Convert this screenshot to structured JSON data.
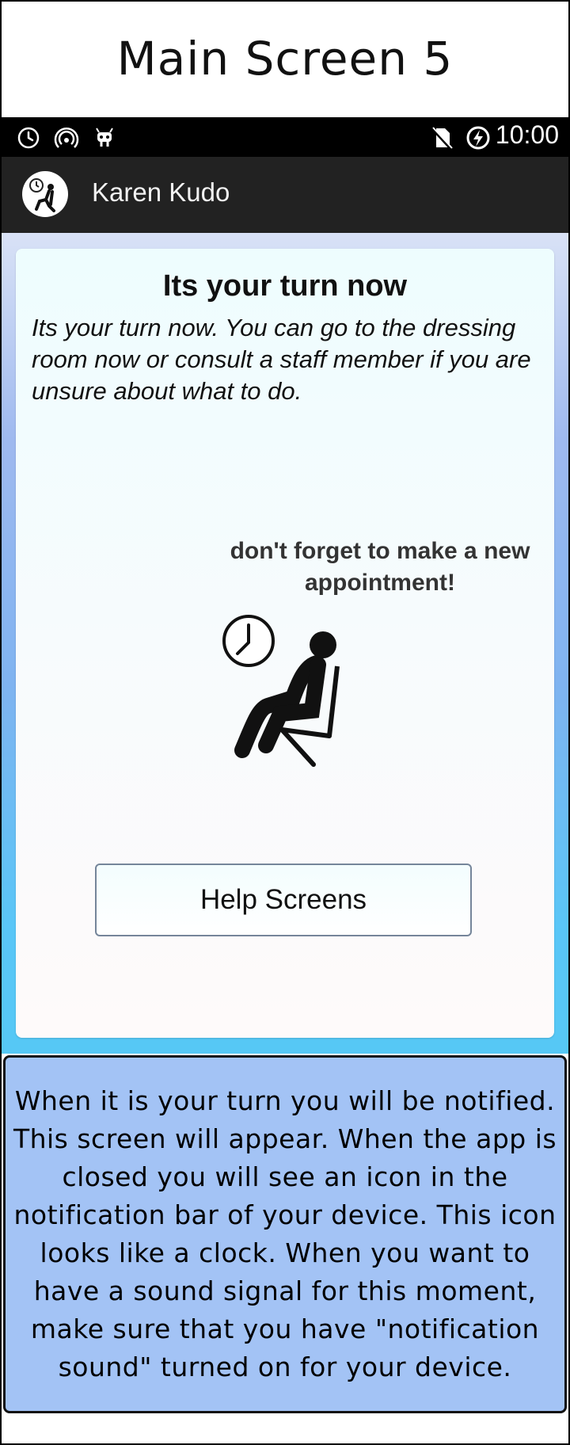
{
  "screen": {
    "title": "Main Screen 5"
  },
  "status_bar": {
    "time": "10:00",
    "icons": [
      "alarm-clock-icon",
      "hotspot-icon",
      "android-debug-icon",
      "no-sim-icon",
      "battery-charging-icon"
    ]
  },
  "app_bar": {
    "user_name": "Karen Kudo",
    "avatar_icon": "waiting-person-icon"
  },
  "card": {
    "title": "Its your turn now",
    "description": "Its your turn now. You can go to the dressing room now or consult a staff member if you are unsure about what to do.",
    "reminder": "don't forget to make a new appointment!",
    "illustration": "waiting-person-icon",
    "help_button_label": "Help Screens"
  },
  "annotation": {
    "text": "When it is your turn you will be notified. This screen will appear. When the app is closed you will see an icon in the notification bar of your device. This icon looks like a clock. When you want to have a sound signal for this moment, make sure that you have \"notification sound\" turned on for your device."
  },
  "colors": {
    "status_bar": "#000000",
    "app_bar": "#222222",
    "annotation_bg": "#a3c3f5",
    "gradient_top": "#d9e2f6",
    "gradient_bottom": "#56c8f5"
  }
}
